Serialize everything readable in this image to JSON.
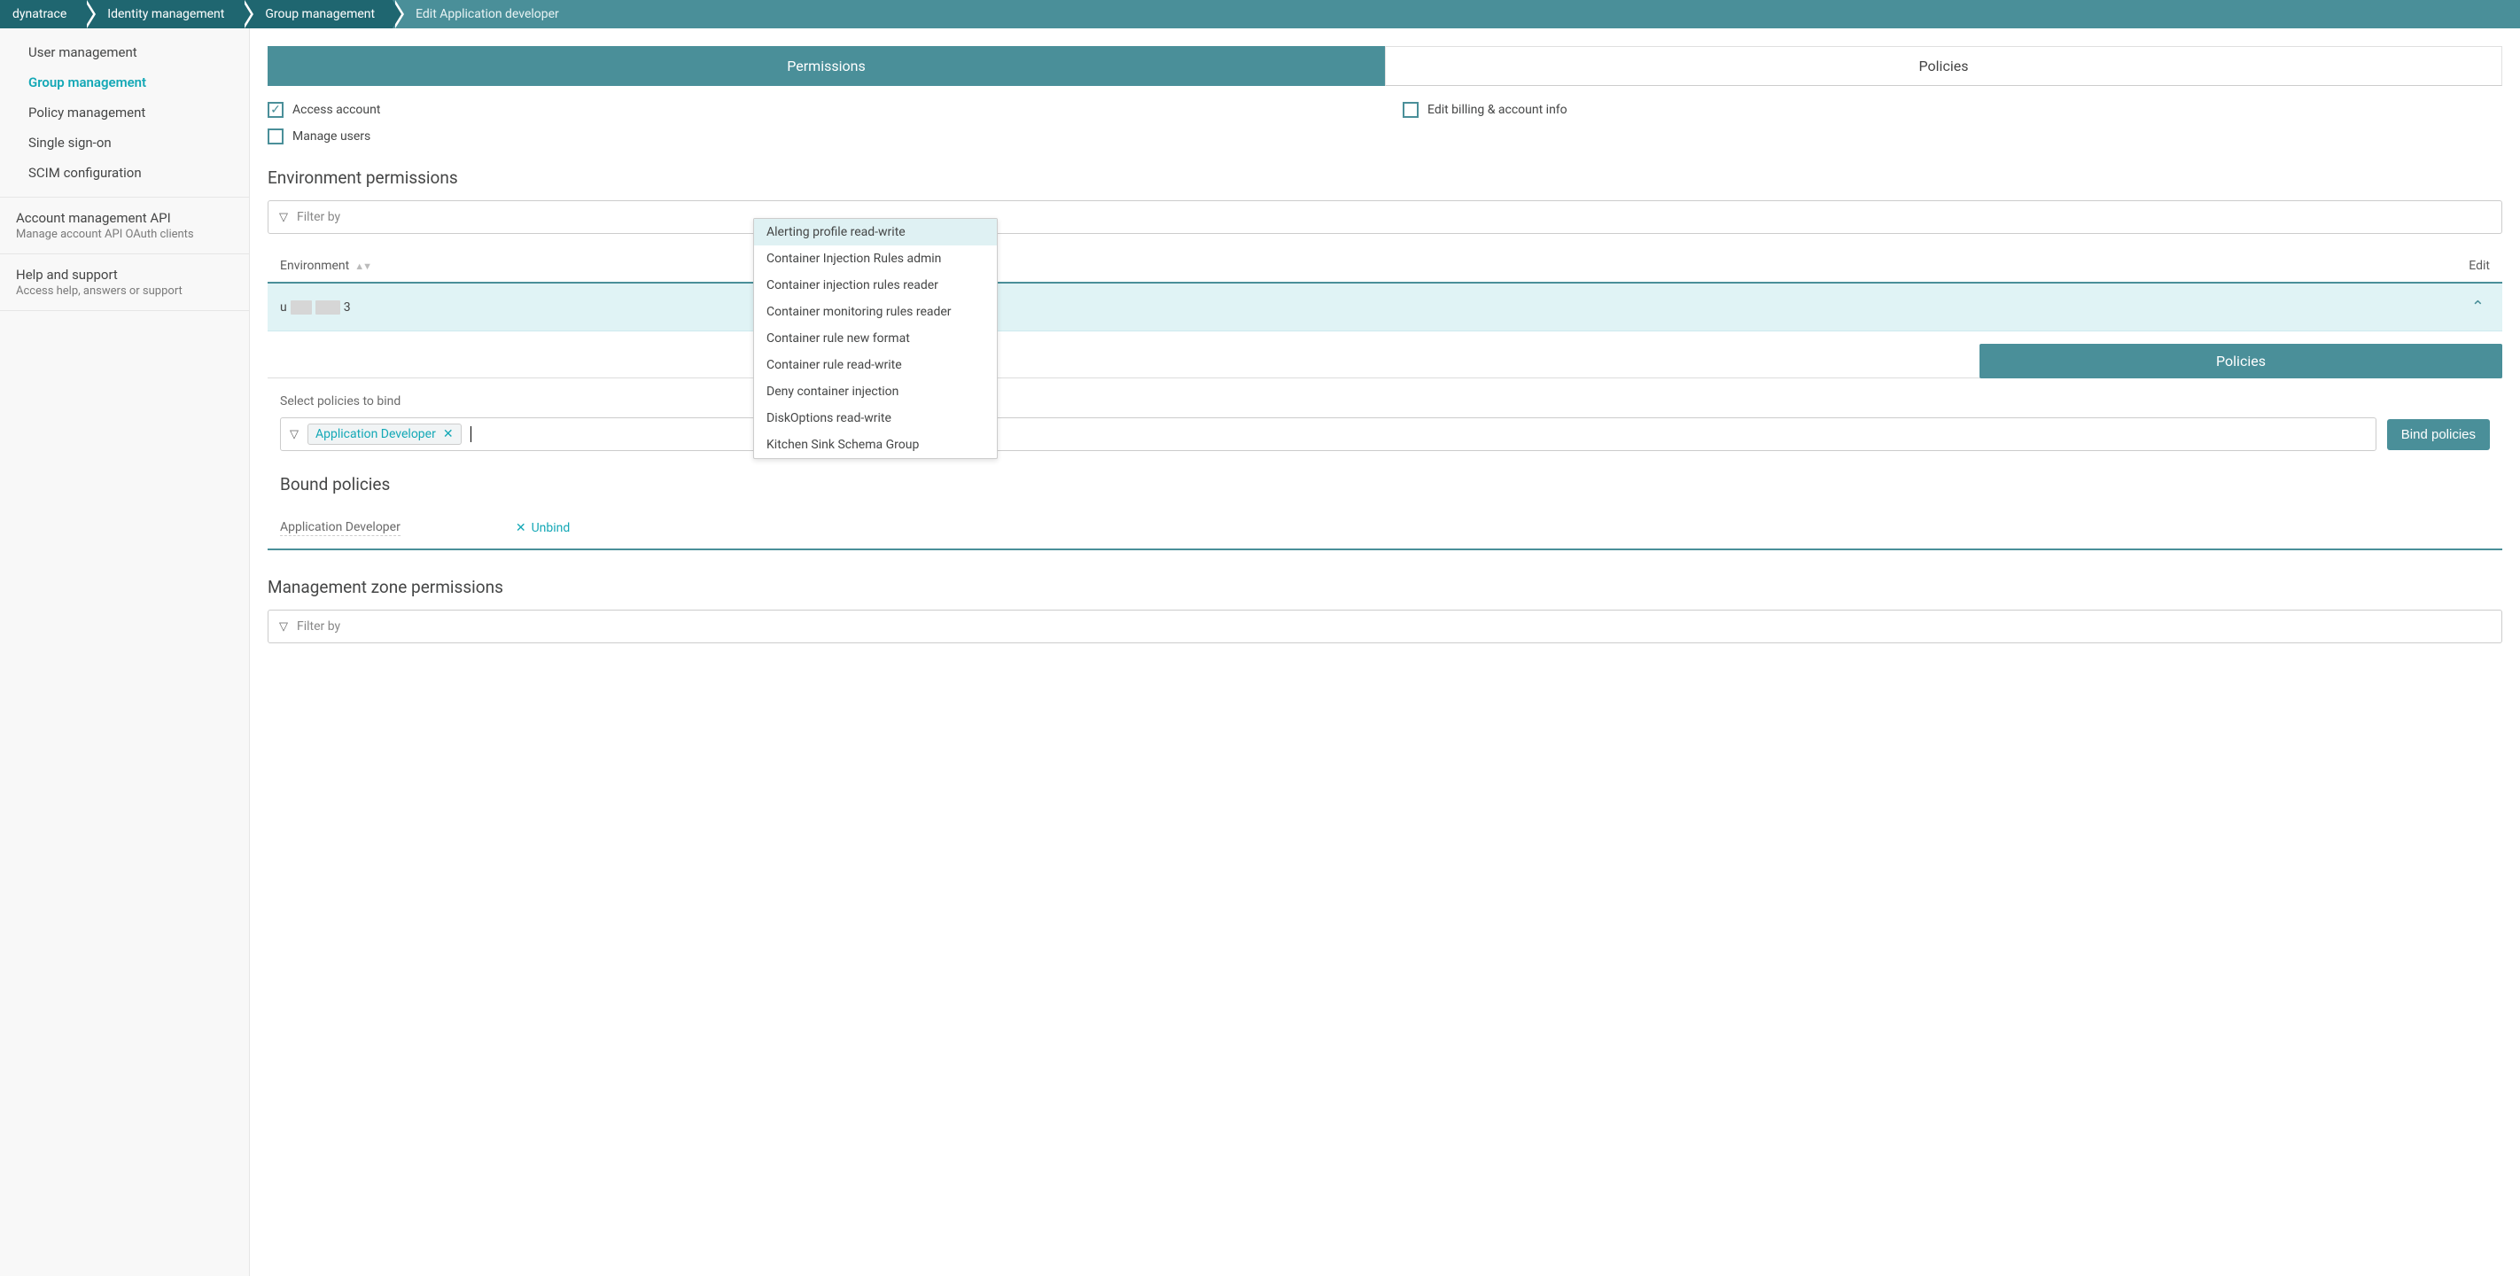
{
  "breadcrumb": [
    "dynatrace",
    "Identity management",
    "Group management",
    "Edit Application developer"
  ],
  "sidebar": {
    "items": [
      {
        "label": "User management",
        "active": false
      },
      {
        "label": "Group management",
        "active": true
      },
      {
        "label": "Policy management",
        "active": false
      },
      {
        "label": "Single sign-on",
        "active": false
      },
      {
        "label": "SCIM configuration",
        "active": false
      }
    ],
    "blocks": [
      {
        "title": "Account management API",
        "sub": "Manage account API OAuth clients"
      },
      {
        "title": "Help and support",
        "sub": "Access help, answers or support"
      }
    ]
  },
  "tabs": {
    "permissions": "Permissions",
    "policies": "Policies",
    "active": "permissions"
  },
  "checkboxes": {
    "access_account": {
      "label": "Access account",
      "checked": true
    },
    "manage_users": {
      "label": "Manage users",
      "checked": false
    },
    "edit_billing": {
      "label": "Edit billing & account info",
      "checked": false
    }
  },
  "sections": {
    "env_perms": "Environment permissions",
    "mz_perms": "Management zone permissions",
    "select_bind": "Select policies to bind",
    "bound": "Bound policies"
  },
  "filter_placeholder": "Filter by",
  "env_table": {
    "col1": "Environment",
    "col2": "Edit",
    "row_start": "u",
    "row_end": "3"
  },
  "subtab": "Policies",
  "policy_chip": "Application Developer",
  "bind_btn": "Bind policies",
  "bound_policy": "Application Developer",
  "unbind_label": "Unbind",
  "dropdown_items": [
    "Alerting profile read-write",
    "Container Injection Rules admin",
    "Container injection rules reader",
    "Container monitoring rules reader",
    "Container rule new format",
    "Container rule read-write",
    "Deny container injection",
    "DiskOptions read-write",
    "Kitchen Sink Schema Group"
  ]
}
